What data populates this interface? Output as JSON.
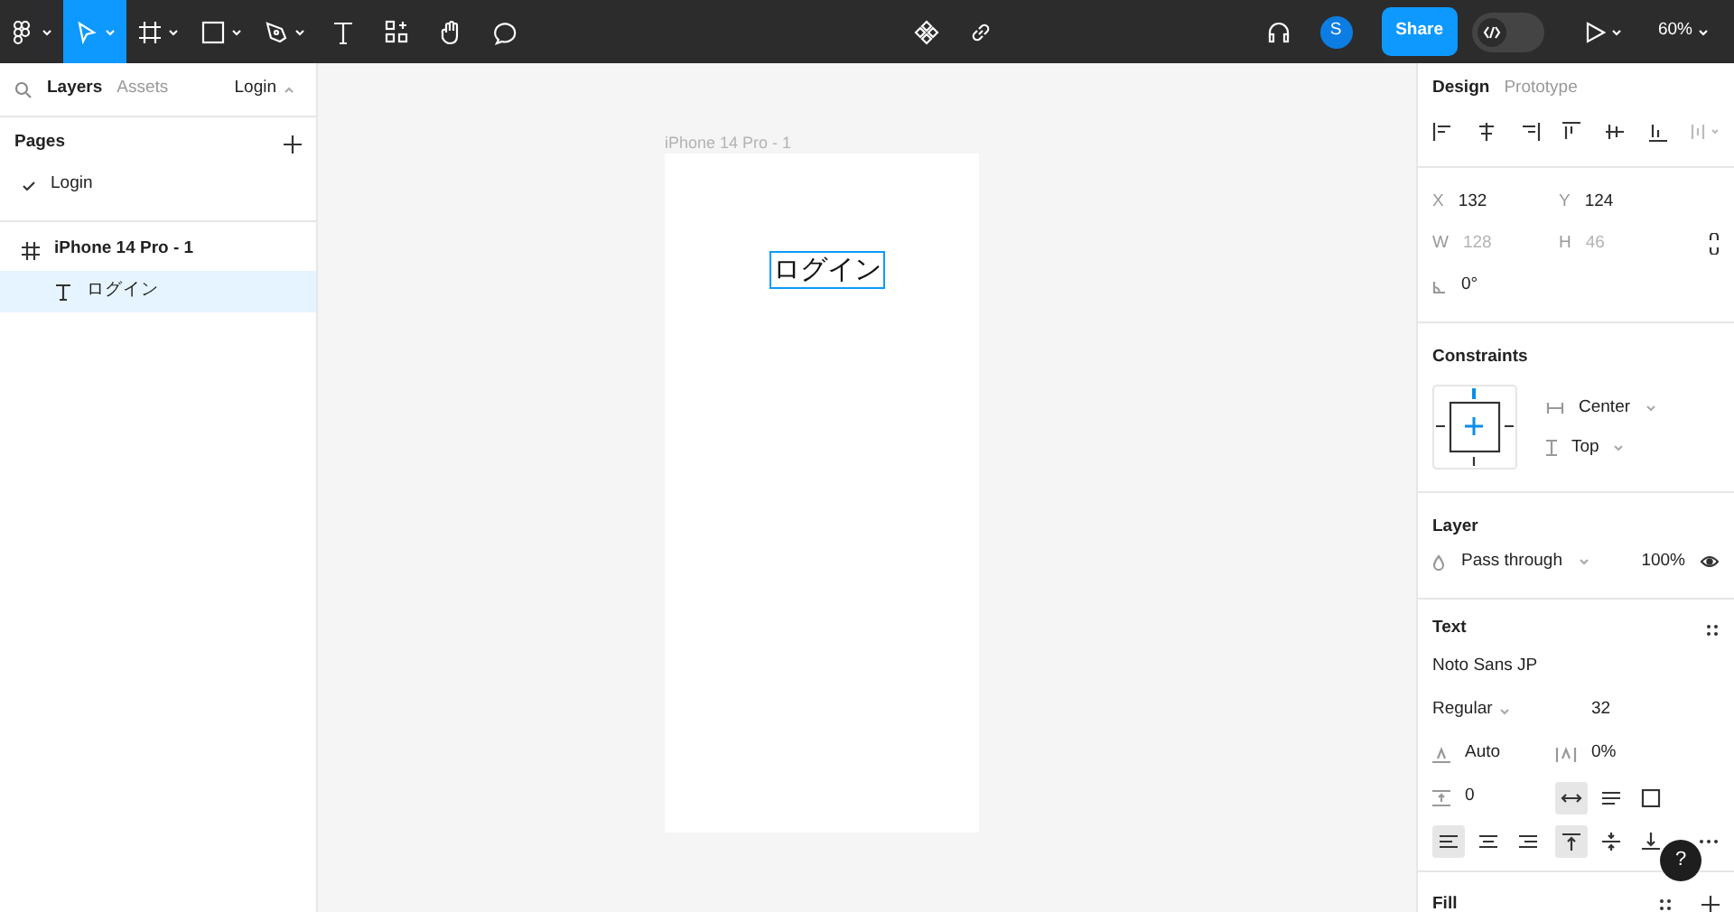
{
  "toolbar": {
    "tools": [
      {
        "kind": "main-menu",
        "selected": false,
        "has_menu": true
      },
      {
        "kind": "move",
        "selected": true,
        "has_menu": true
      },
      {
        "kind": "frame",
        "selected": false,
        "has_menu": true
      },
      {
        "kind": "shape",
        "selected": false,
        "has_menu": true
      },
      {
        "kind": "pen",
        "selected": false,
        "has_menu": true
      },
      {
        "kind": "text",
        "selected": false,
        "has_menu": false
      },
      {
        "kind": "resources",
        "selected": false,
        "has_menu": false
      },
      {
        "kind": "hand",
        "selected": false,
        "has_menu": false
      },
      {
        "kind": "comment",
        "selected": false,
        "has_menu": false
      }
    ],
    "avatar": "S",
    "share": "Share",
    "dev_mode": false,
    "zoom": "60%"
  },
  "left_panel": {
    "tabs": [
      {
        "label": "Layers",
        "selected": true
      },
      {
        "label": "Assets",
        "selected": false
      }
    ],
    "page_switcher": "Login",
    "pages": {
      "title": "Pages",
      "items": [
        {
          "label": "Login",
          "selected": true
        }
      ]
    },
    "layers": [
      {
        "label": "iPhone 14 Pro - 1",
        "kind": "frame",
        "selected": false,
        "children": [
          {
            "label": "ログイン",
            "kind": "text",
            "selected": true
          }
        ]
      }
    ]
  },
  "canvas": {
    "frame_label": "iPhone 14 Pro - 1",
    "text_layer": "ログイン"
  },
  "right_panel": {
    "tabs": [
      {
        "label": "Design",
        "selected": true
      },
      {
        "label": "Prototype",
        "selected": false
      }
    ],
    "position": [
      {
        "label": "X",
        "value": "132",
        "disabled": false
      },
      {
        "label": "Y",
        "value": "124",
        "disabled": false
      },
      {
        "label": "W",
        "value": "128",
        "disabled": true
      },
      {
        "label": "H",
        "value": "46",
        "disabled": true
      }
    ],
    "rotation": "0°",
    "constraints": {
      "title": "Constraints",
      "horizontal": "Center",
      "vertical": "Top"
    },
    "layer": {
      "title": "Layer",
      "blend": "Pass through",
      "opacity": "100%"
    },
    "text": {
      "title": "Text",
      "font": "Noto Sans JP",
      "weight": "Regular",
      "size": "32",
      "line_height": "Auto",
      "letter_spacing": "0%",
      "paragraph_spacing": "0",
      "resizing": [
        {
          "kind": "auto-width",
          "selected": true
        },
        {
          "kind": "auto-height",
          "selected": false
        },
        {
          "kind": "fixed",
          "selected": false
        }
      ],
      "align_h": [
        {
          "kind": "left",
          "selected": true
        },
        {
          "kind": "center",
          "selected": false
        },
        {
          "kind": "right",
          "selected": false
        }
      ],
      "align_v": [
        {
          "kind": "top",
          "selected": true
        },
        {
          "kind": "middle",
          "selected": false
        },
        {
          "kind": "bottom",
          "selected": false
        }
      ]
    },
    "fill": {
      "title": "Fill"
    },
    "help": "?"
  }
}
